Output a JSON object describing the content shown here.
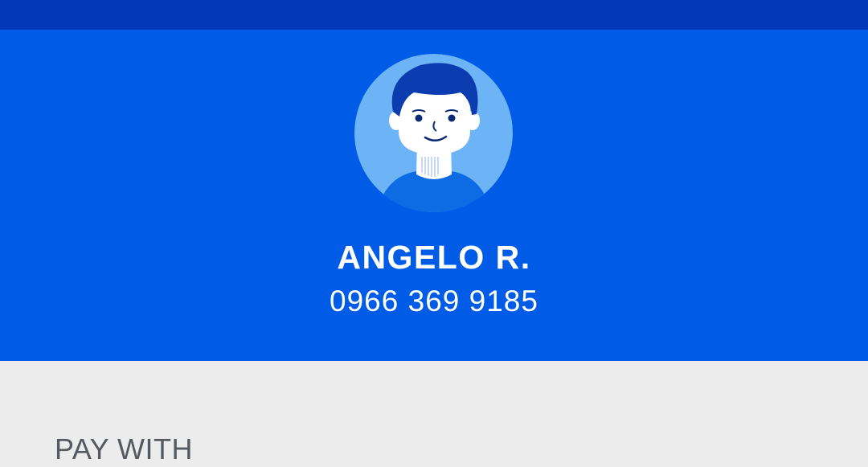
{
  "profile": {
    "avatar_icon": "user-avatar-boy-icon",
    "name": "ANGELO R.",
    "phone": "0966 369 9185"
  },
  "payment": {
    "section_label": "PAY WITH"
  },
  "colors": {
    "status_bar": "#0038b8",
    "header_bg": "#005ce6",
    "page_bg": "#ececec",
    "avatar_bg": "#6cb4f5"
  }
}
